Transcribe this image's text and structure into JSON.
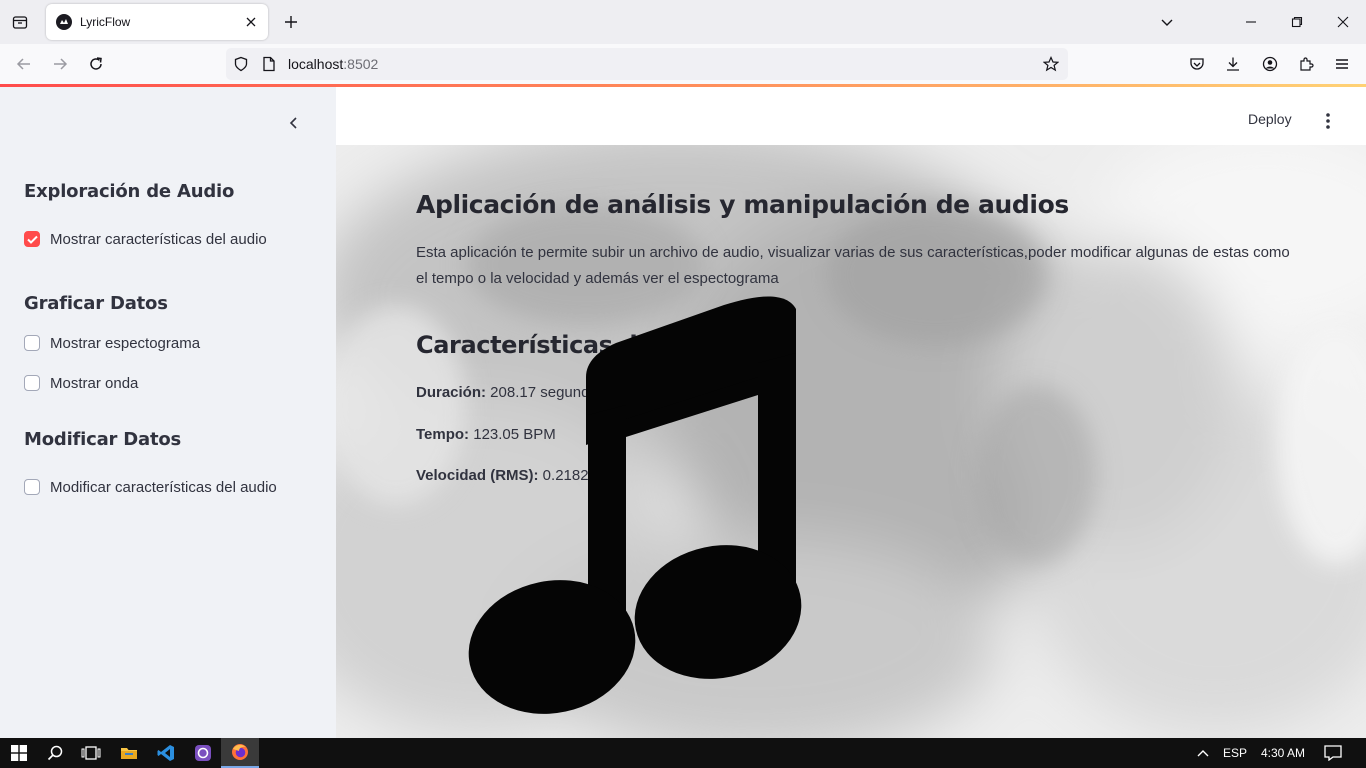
{
  "browser": {
    "tab_title": "LyricFlow",
    "url_host": "localhost",
    "url_port": ":8502"
  },
  "app": {
    "header": {
      "deploy_label": "Deploy"
    },
    "sidebar": {
      "sections": [
        {
          "heading": "Exploración de Audio",
          "checkboxes": [
            {
              "label": "Mostrar características del audio",
              "checked": true
            }
          ]
        },
        {
          "heading": "Graficar Datos",
          "checkboxes": [
            {
              "label": "Mostrar espectograma",
              "checked": false
            },
            {
              "label": "Mostrar onda",
              "checked": false
            }
          ]
        },
        {
          "heading": "Modificar Datos",
          "checkboxes": [
            {
              "label": "Modificar características del audio",
              "checked": false
            }
          ]
        }
      ]
    },
    "main": {
      "title": "Aplicación de análisis y manipulación de audios",
      "description": "Esta aplicación te permite subir un archivo de audio, visualizar varias de sus características,poder modificar algunas de estas como el tempo o la velocidad y además ver el espectograma",
      "features_heading": "Características del audio",
      "features": [
        {
          "label": "Duración:",
          "value": " 208.17 segundos"
        },
        {
          "label": "Tempo:",
          "value": " 123.05 BPM"
        },
        {
          "label": "Velocidad (RMS):",
          "value": " 0.2182"
        }
      ],
      "image_icon": "music-note-icon"
    },
    "colors": {
      "accent": "#ff4b4b",
      "sidebar_bg": "#f0f2f6",
      "text": "#31333f"
    }
  },
  "taskbar": {
    "language": "ESP",
    "time": "4:30 AM",
    "apps": [
      "windows-start-icon",
      "search-icon",
      "task-view-icon",
      "file-explorer-icon",
      "vscode-icon",
      "github-desktop-icon",
      "firefox-icon"
    ]
  }
}
